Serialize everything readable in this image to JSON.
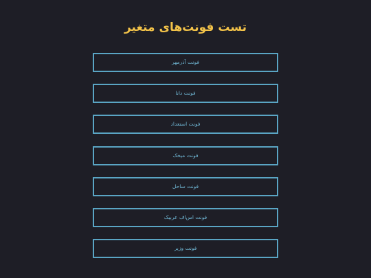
{
  "page": {
    "title": "تست فونت‌های متغیر"
  },
  "buttons": [
    {
      "label": "فونت آذرمهر"
    },
    {
      "label": "فونت دانا"
    },
    {
      "label": "فونت استعداد"
    },
    {
      "label": "فونت میخک"
    },
    {
      "label": "فونت ساحل"
    },
    {
      "label": "فونت اس‌اف عربیک"
    },
    {
      "label": "فونت وزیر"
    }
  ],
  "colors": {
    "background": "#1e1e26",
    "title": "#f3c349",
    "button_border": "#5aa5c4",
    "button_text": "#6fb5d2"
  }
}
